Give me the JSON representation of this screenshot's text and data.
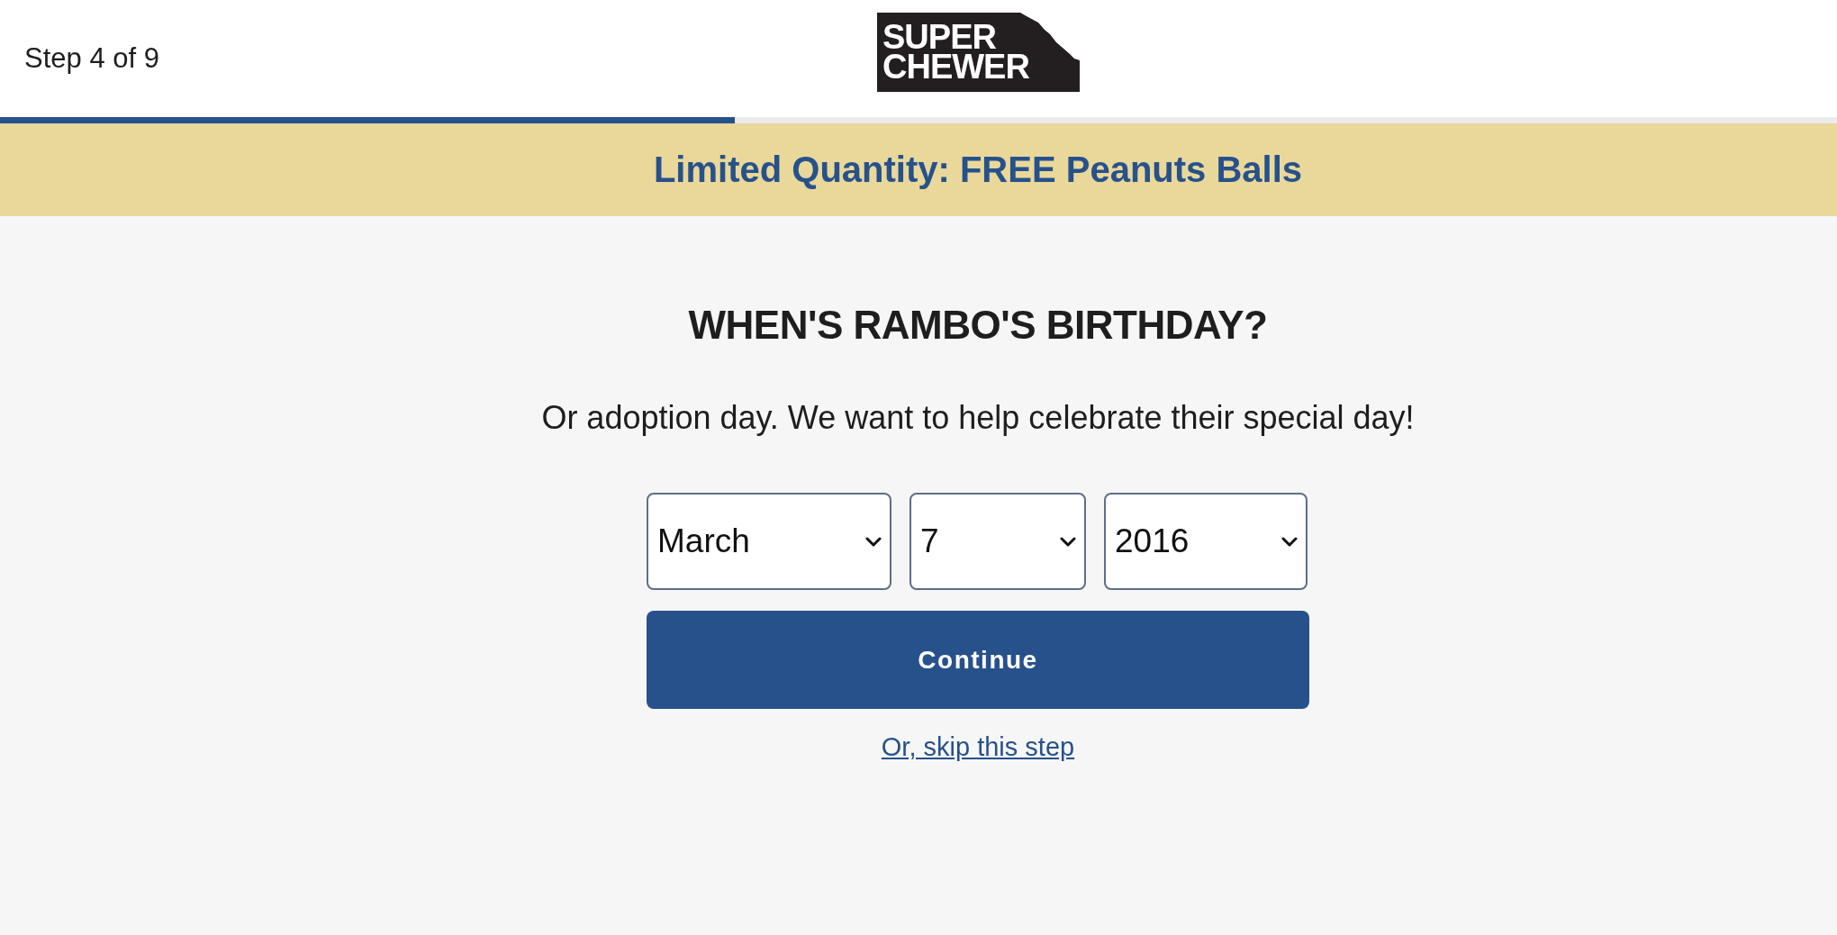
{
  "header": {
    "step": "Step 4 of 9",
    "logo": {
      "lines": [
        "SUPER",
        "CHEWER"
      ]
    }
  },
  "progress": {
    "level": 0.4
  },
  "banner": {
    "text": "Limited Quantity: FREE Peanuts Balls"
  },
  "question": {
    "title": "WHEN'S RAMBO'S BIRTHDAY?",
    "subtitle": "Or adoption day. We want to help celebrate their special day!"
  },
  "date_fields": [
    {
      "kind": "month",
      "value": "March"
    },
    {
      "kind": "day",
      "value": "7"
    },
    {
      "kind": "year",
      "value": "2016"
    }
  ],
  "continue_button": {
    "label": "Continue"
  },
  "skip_link": {
    "label": "Or, skip this step"
  }
}
